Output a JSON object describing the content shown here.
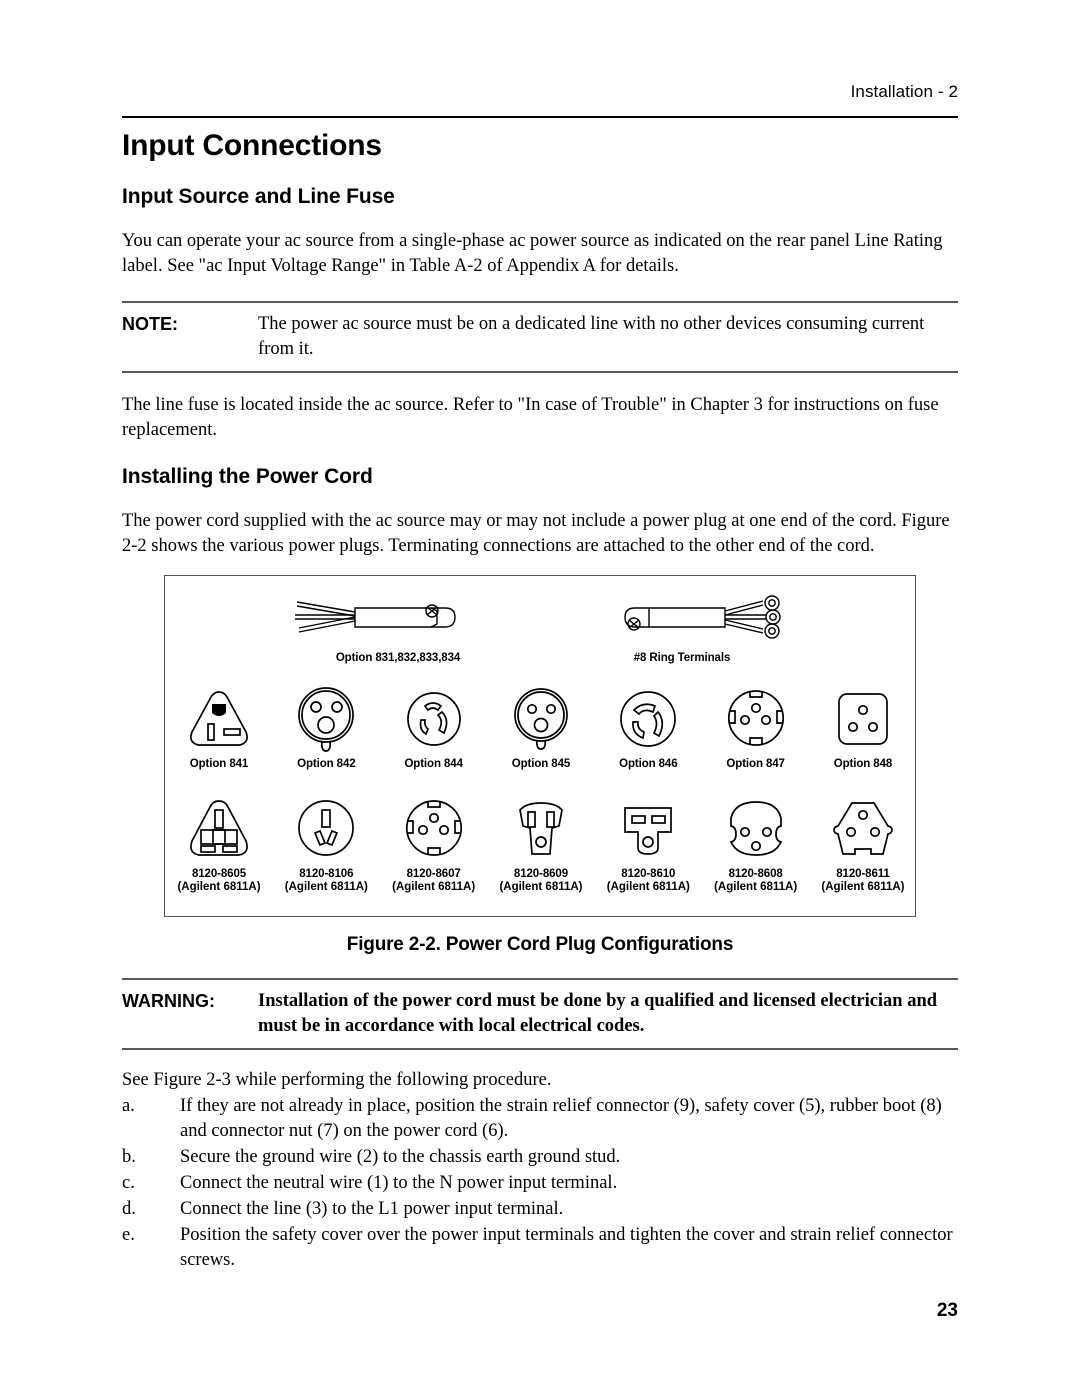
{
  "header": {
    "running_head": "Installation - 2"
  },
  "chapter_title": "Input Connections",
  "sections": [
    {
      "title": "Input Source and Line Fuse",
      "paragraph": "You can operate your ac source from a single-phase ac power source as indicated on the rear panel Line Rating label. See \"ac Input Voltage Range\" in Table A-2 of Appendix A for details."
    },
    {
      "title": "Installing the Power Cord",
      "paragraph": "The power cord supplied with the ac source may or may not include a power plug at one end of the cord. Figure 2-2 shows the various power plugs. Terminating connections are attached to the other end of the cord."
    }
  ],
  "note": {
    "label": "NOTE:",
    "text": "The power ac source must be on a dedicated line with no other devices consuming current from it."
  },
  "fuse_paragraph": "The line fuse is located inside the ac source. Refer to \"In case of Trouble\" in Chapter 3 for instructions on fuse replacement.",
  "figure": {
    "caption": "Figure 2-2. Power Cord Plug Configurations",
    "cords": [
      {
        "name": "stripped-leads-cord",
        "label": "Option 831,832,833,834"
      },
      {
        "name": "ring-terminal-cord",
        "label": "#8 Ring Terminals"
      }
    ],
    "plugs_row1": [
      {
        "name": "plug-option-841",
        "label": "Option 841"
      },
      {
        "name": "plug-option-842",
        "label": "Option 842"
      },
      {
        "name": "plug-option-844",
        "label": "Option 844"
      },
      {
        "name": "plug-option-845",
        "label": "Option 845"
      },
      {
        "name": "plug-option-846",
        "label": "Option 846"
      },
      {
        "name": "plug-option-847",
        "label": "Option 847"
      },
      {
        "name": "plug-option-848",
        "label": "Option 848"
      }
    ],
    "plugs_row2": [
      {
        "name": "plug-8120-8605",
        "label": "8120-8605",
        "sub": "(Agilent 6811A)"
      },
      {
        "name": "plug-8120-8106",
        "label": "8120-8106",
        "sub": "(Agilent 6811A)"
      },
      {
        "name": "plug-8120-8607",
        "label": "8120-8607",
        "sub": "(Agilent 6811A)"
      },
      {
        "name": "plug-8120-8609",
        "label": "8120-8609",
        "sub": "(Agilent 6811A)"
      },
      {
        "name": "plug-8120-8610",
        "label": "8120-8610",
        "sub": "(Agilent 6811A)"
      },
      {
        "name": "plug-8120-8608",
        "label": "8120-8608",
        "sub": "(Agilent 6811A)"
      },
      {
        "name": "plug-8120-8611",
        "label": "8120-8611",
        "sub": "(Agilent 6811A)"
      }
    ]
  },
  "warning": {
    "label": "WARNING:",
    "text": "Installation of the power cord must be done by a qualified and licensed electrician and must be in accordance with local electrical codes."
  },
  "procedure": {
    "intro": "See Figure 2-3 while performing the following  procedure.",
    "items": [
      {
        "marker": "a.",
        "text": "If they are not already in place, position the strain relief connector (9), safety cover (5), rubber boot (8) and connector nut (7) on the power cord (6)."
      },
      {
        "marker": "b.",
        "text": "Secure the ground wire (2) to the chassis earth ground stud."
      },
      {
        "marker": "c.",
        "text": "Connect the neutral wire (1) to the N power input terminal."
      },
      {
        "marker": "d.",
        "text": "Connect the line (3) to the L1 power input terminal."
      },
      {
        "marker": "e.",
        "text": "Position the safety cover over the power input terminals and tighten the cover and strain relief connector screws."
      }
    ]
  },
  "footer": {
    "page_number": "23"
  }
}
